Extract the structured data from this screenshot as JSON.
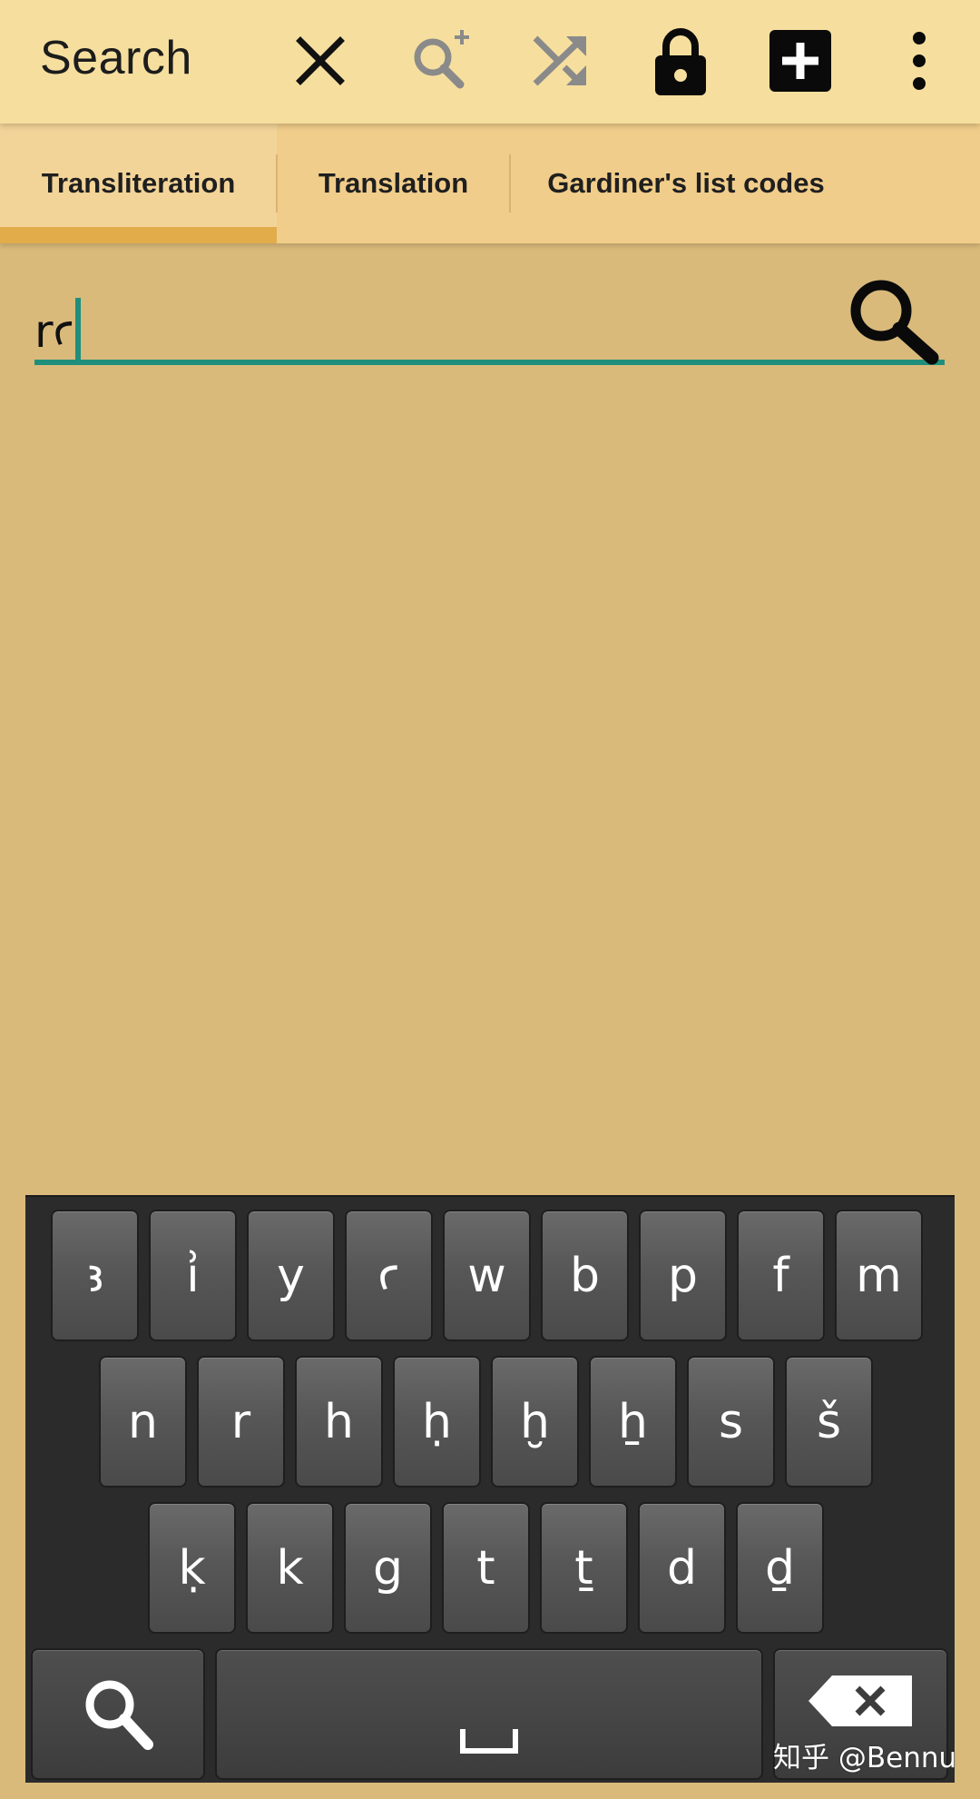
{
  "toolbar": {
    "title": "Search",
    "icons": [
      "close-icon",
      "search-plus-icon",
      "shuffle-icon",
      "lock-icon",
      "add-box-icon",
      "more-vert-icon"
    ]
  },
  "tabs": [
    {
      "label": "Transliteration",
      "active": true
    },
    {
      "label": "Translation",
      "active": false
    },
    {
      "label": "Gardiner's list codes",
      "active": false
    }
  ],
  "search": {
    "value": "rꜥ",
    "button_icon": "search-icon"
  },
  "keyboard": {
    "row1": [
      "ꜣ",
      "i͗",
      "y",
      "ꜥ",
      "w",
      "b",
      "p",
      "f",
      "m"
    ],
    "row2": [
      "n",
      "r",
      "h",
      "ḥ",
      "ḫ",
      "ẖ",
      "s",
      "š"
    ],
    "row3": [
      "ḳ",
      "k",
      "g",
      "t",
      "ṯ",
      "d",
      "ḏ"
    ],
    "bottom": {
      "search_icon": "search-icon",
      "space_label": "␣",
      "backspace_icon": "backspace-icon"
    }
  },
  "watermark": "知乎 @Bennu",
  "colors": {
    "toolbar": "#f6df9e",
    "tabs": "#f1cd8b",
    "tab_indicator": "#e2ac4a",
    "content": "#d9ba7b",
    "input_accent": "#1f8f7c",
    "keyboard_bg": "#2b2b2b"
  }
}
